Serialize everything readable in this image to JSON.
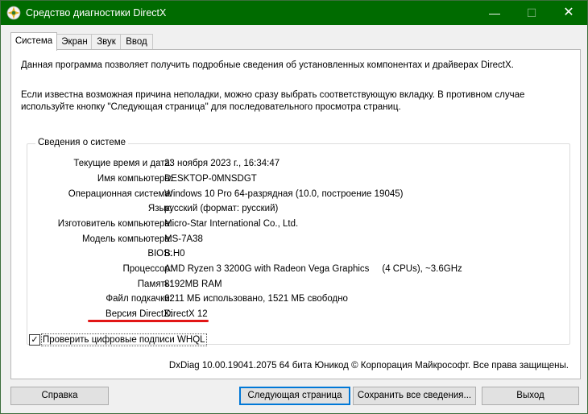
{
  "window": {
    "title": "Средство диагностики DirectX",
    "minimize_glyph": "—",
    "maximize_glyph": "☐",
    "close_glyph": "✕"
  },
  "tabs": [
    {
      "label": "Система",
      "active": true
    },
    {
      "label": "Экран",
      "active": false
    },
    {
      "label": "Звук",
      "active": false
    },
    {
      "label": "Ввод",
      "active": false
    }
  ],
  "intro": {
    "line1": "Данная программа позволяет получить подробные сведения об установленных компонентах и драйверах DirectX.",
    "line2": "Если известна возможная причина неполадки, можно сразу выбрать соответствующую вкладку. В противном случае используйте кнопку \"Следующая страница\" для последовательного просмотра страниц."
  },
  "system_info": {
    "group_label": "Сведения о системе",
    "rows": [
      {
        "label": "Текущие время и дата:",
        "value": "23 ноября 2023 г., 16:34:47"
      },
      {
        "label": "Имя компьютера:",
        "value": "DESKTOP-0MNSDGT"
      },
      {
        "label": "Операционная система:",
        "value": "Windows 10 Pro 64-разрядная (10.0, построение 19045)"
      },
      {
        "label": "Язык:",
        "value": "русский (формат: русский)"
      },
      {
        "label": "Изготовитель компьютера:",
        "value": "Micro-Star International Co., Ltd."
      },
      {
        "label": "Модель компьютера:",
        "value": "MS-7A38"
      },
      {
        "label": "BIOS:",
        "value": "B.H0"
      },
      {
        "label": "Процессор:",
        "value": "AMD Ryzen 3 3200G with Radeon Vega Graphics     (4 CPUs), ~3.6GHz"
      },
      {
        "label": "Память:",
        "value": "8192MB RAM"
      },
      {
        "label": "Файл подкачки:",
        "value": "6211 МБ использовано, 1521 МБ свободно"
      },
      {
        "label": "Версия DirectX:",
        "value": "DirectX 12"
      }
    ]
  },
  "whql": {
    "label": "Проверить цифровые подписи WHQL",
    "checked": true,
    "check_glyph": "✓"
  },
  "copyright": "DxDiag 10.00.19041.2075 64 бита Юникод  © Корпорация Майкрософт. Все права защищены.",
  "buttons": {
    "help": "Справка",
    "next": "Следующая страница",
    "save": "Сохранить все сведения...",
    "exit": "Выход"
  },
  "colors": {
    "titlebar": "#006b00",
    "highlight_underline": "#e21616",
    "default_button_border": "#0078d7"
  }
}
